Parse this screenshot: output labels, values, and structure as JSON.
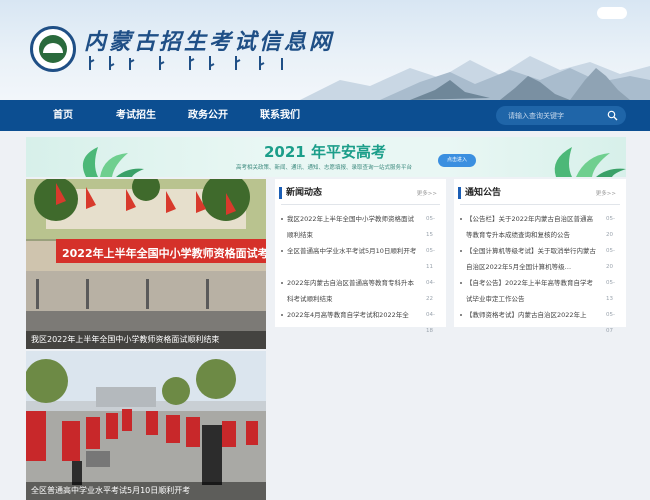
{
  "header": {
    "site_title": "内蒙古招生考试信息网",
    "logo_icon": "logo-icon"
  },
  "nav": {
    "items": [
      {
        "label": "首页"
      },
      {
        "label": "考试招生"
      },
      {
        "label": "政务公开"
      },
      {
        "label": "联系我们"
      }
    ],
    "search_placeholder": "请输入查询关键字",
    "search_icon": "search-icon"
  },
  "banner": {
    "title": "2021 年平安高考",
    "subtitle": "高考相关政策、新闻、通讯、通知、志愿填报、录取查询一站式服务平台",
    "button_label": "点击进入",
    "colors": {
      "accent": "#1c9e8a",
      "button": "#3b8fe0"
    }
  },
  "photos": [
    {
      "caption": "我区2022年上半年全国中小学教师资格面试顺利结束",
      "sign_text": "2022年上半年全国中小学教师资格面试考场"
    },
    {
      "caption": "全区普通高中学业水平考试5月10日顺利开考"
    }
  ],
  "news": {
    "title": "新闻动态",
    "more": "更多>>",
    "items": [
      {
        "text": "我区2022年上半年全国中小学教师资格面试顺利结束",
        "date": "05-15"
      },
      {
        "text": "全区普通高中学业水平考试5月10日顺利开考",
        "date": "05-11"
      },
      {
        "text": "2022年内蒙古自治区普通高等教育专科升本科考试顺利结束",
        "date": "04-22"
      },
      {
        "text": "2022年4月高等教育自学考试和2022年全",
        "date": "04-18"
      }
    ]
  },
  "notice": {
    "title": "通知公告",
    "more": "更多>>",
    "items": [
      {
        "text": "【公告栏】关于2022年内蒙古自治区普通高等教育专升本成绩查询和复核的公告",
        "date": "05-20"
      },
      {
        "text": "【全国计算机等级考试】关于取消举行内蒙古自治区2022年5月全国计算机等级…",
        "date": "05-20"
      },
      {
        "text": "【自考公告】2022年上半年高等教育自学考试毕业审定工作公告",
        "date": "05-13"
      },
      {
        "text": "【教师资格考试】内蒙古自治区2022年上",
        "date": "05-07"
      }
    ]
  },
  "colors": {
    "nav": "#0c4e91",
    "brand": "#1f4f86"
  }
}
